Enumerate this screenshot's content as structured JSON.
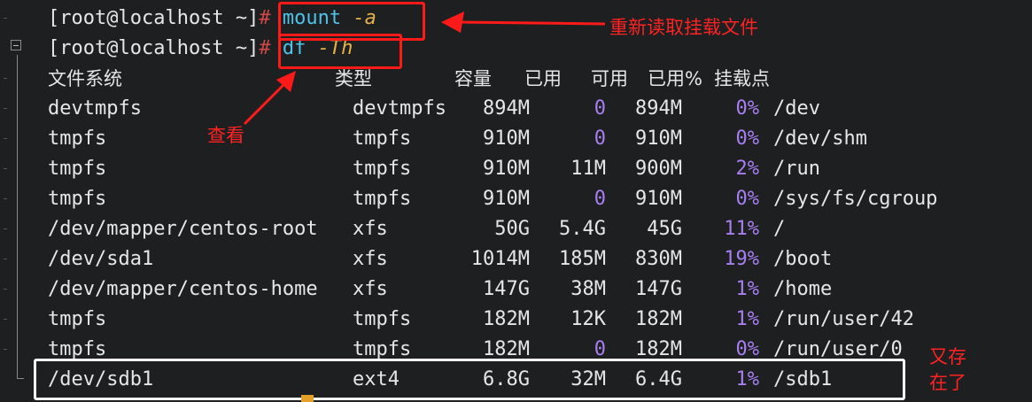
{
  "commands": [
    {
      "prompt": "[root@localhost ~]",
      "hash": "#",
      "cmd": "mount",
      "flag": "-a"
    },
    {
      "prompt": "[root@localhost ~]",
      "hash": "#",
      "cmd": "df",
      "flag": "-Th"
    }
  ],
  "table": {
    "headers": [
      "文件系统",
      "类型",
      "容量",
      "已用",
      "可用",
      "已用%",
      "挂载点"
    ],
    "rows": [
      [
        "devtmpfs",
        "devtmpfs",
        "894M",
        "0",
        "894M",
        "0%",
        "/dev"
      ],
      [
        "tmpfs",
        "tmpfs",
        "910M",
        "0",
        "910M",
        "0%",
        "/dev/shm"
      ],
      [
        "tmpfs",
        "tmpfs",
        "910M",
        "11M",
        "900M",
        "2%",
        "/run"
      ],
      [
        "tmpfs",
        "tmpfs",
        "910M",
        "0",
        "910M",
        "0%",
        "/sys/fs/cgroup"
      ],
      [
        "/dev/mapper/centos-root",
        "xfs",
        "50G",
        "5.4G",
        "45G",
        "11%",
        "/"
      ],
      [
        "/dev/sda1",
        "xfs",
        "1014M",
        "185M",
        "830M",
        "19%",
        "/boot"
      ],
      [
        "/dev/mapper/centos-home",
        "xfs",
        "147G",
        "38M",
        "147G",
        "1%",
        "/home"
      ],
      [
        "tmpfs",
        "tmpfs",
        "182M",
        "12K",
        "182M",
        "1%",
        "/run/user/42"
      ],
      [
        "tmpfs",
        "tmpfs",
        "182M",
        "0",
        "182M",
        "0%",
        "/run/user/0"
      ],
      [
        "/dev/sdb1",
        "ext4",
        "6.8G",
        "32M",
        "6.4G",
        "1%",
        "/sdb1"
      ]
    ]
  },
  "annotations": {
    "reread": "重新读取挂载文件",
    "view": "查看",
    "still_exists": "又存\n在了"
  },
  "colors": {
    "background": "#1d1f21",
    "command": "#4ec2e8",
    "flag": "#e5b04a",
    "percent_and_zero": "#a77ff0",
    "annotation_red": "#ff1a1a",
    "highlight_white": "#ffffff"
  }
}
